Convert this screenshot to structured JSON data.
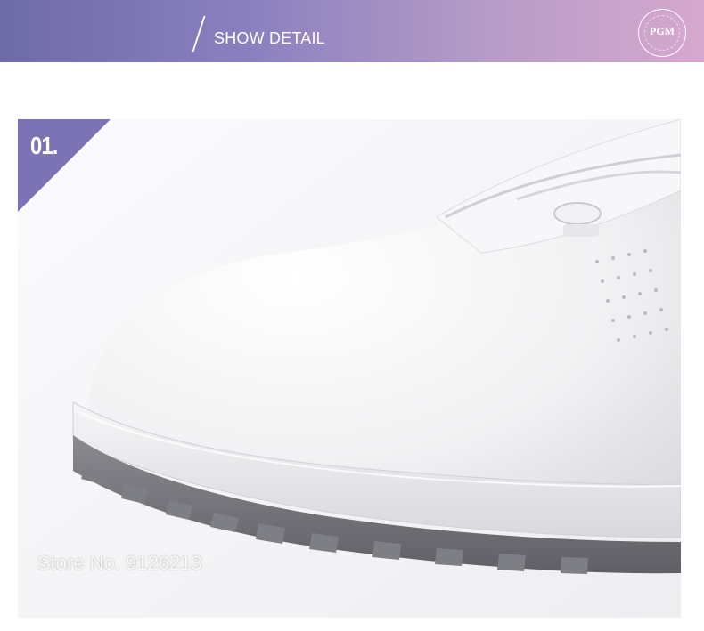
{
  "banner": {
    "title": "SHOW DETAIL",
    "logo_text": "PGM",
    "gradient_start": "#6e6aa8",
    "gradient_end": "#d6a8cf"
  },
  "photo": {
    "badge_number": "01.",
    "badge_color": "#7b73b3",
    "watermark": "Store No. 9126",
    "watermark_tail": "213",
    "shoe_upper_color": "#ffffff",
    "sole_color": "#7d7d83"
  }
}
